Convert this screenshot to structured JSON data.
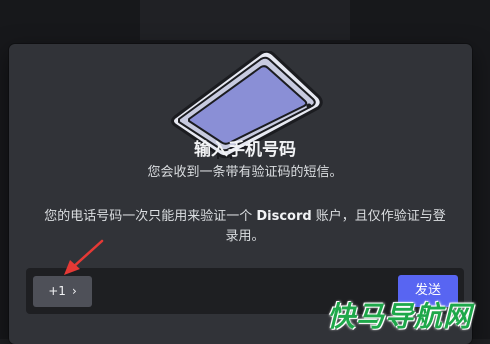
{
  "modal": {
    "title": "输入手机号码",
    "subtitle": "您会收到一条带有验证码的短信。",
    "notice_pre": "您的电话号码一次只能用来验证一个 ",
    "notice_brand": "Discord",
    "notice_post": " 账户，且仅作验证与登录用。"
  },
  "phone_field": {
    "country_code": "+1",
    "placeholder": "",
    "send_label": "发送"
  },
  "watermark": {
    "text": "快马导航网"
  },
  "colors": {
    "accent": "#5865f2",
    "modal_bg": "#313338",
    "field_bg": "#1e1f22",
    "arrow": "#e53935",
    "watermark": "#1ea84a"
  }
}
